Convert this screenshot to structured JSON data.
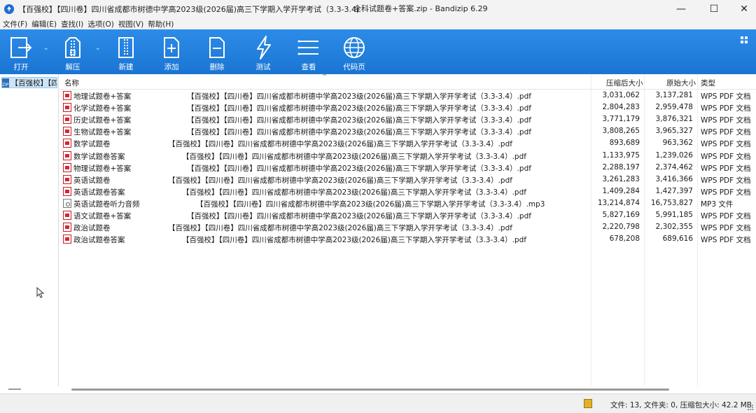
{
  "window": {
    "title_left": "【百强校】【四川卷】四川省成都市树德中学高2023级(2026届)高三下学期入学开学考试（3.3-3.4)",
    "title_center": "全科试题卷+答案.zip - Bandizip 6.29",
    "min_glyph": "—",
    "max_glyph": "☐",
    "close_glyph": "✕"
  },
  "menu": [
    "文件(F)",
    "编辑(E)",
    "查找(I)",
    "选项(O)",
    "视图(V)",
    "帮助(H)"
  ],
  "toolbar": {
    "open": "打开",
    "extract": "解压",
    "new": "新建",
    "add": "添加",
    "delete": "删除",
    "test": "测试",
    "view": "查看",
    "codepage": "代码页"
  },
  "tree": {
    "root_label": "【百强校】【四",
    "zip_label": "ZIP"
  },
  "columns": {
    "name": "名称",
    "compressed": "压缩后大小",
    "original": "原始大小",
    "type": "类型"
  },
  "files": [
    {
      "name": "地理试题卷+答案",
      "path": "【百强校】【四川卷】四川省成都市树德中学高2023级(2026届)高三下学期入学开学考试（3.3-3.4）.pdf",
      "compressed": "3,031,062",
      "original": "3,137,281",
      "type": "WPS PDF 文档"
    },
    {
      "name": "化学试题卷+答案",
      "path": "【百强校】【四川卷】四川省成都市树德中学高2023级(2026届)高三下学期入学开学考试（3.3-3.4）.pdf",
      "compressed": "2,804,283",
      "original": "2,959,478",
      "type": "WPS PDF 文档"
    },
    {
      "name": "历史试题卷+答案",
      "path": "【百强校】【四川卷】四川省成都市树德中学高2023级(2026届)高三下学期入学开学考试（3.3-3.4）.pdf",
      "compressed": "3,771,179",
      "original": "3,876,321",
      "type": "WPS PDF 文档"
    },
    {
      "name": "生物试题卷+答案",
      "path": "【百强校】【四川卷】四川省成都市树德中学高2023级(2026届)高三下学期入学开学考试（3.3-3.4）.pdf",
      "compressed": "3,808,265",
      "original": "3,965,327",
      "type": "WPS PDF 文档"
    },
    {
      "name": "数学试题卷",
      "path": "【百强校】【四川卷】四川省成都市树德中学高2023级(2026届)高三下学期入学开学考试（3.3-3.4）.pdf",
      "compressed": "893,689",
      "original": "963,362",
      "type": "WPS PDF 文档"
    },
    {
      "name": "数学试题卷答案",
      "path": "【百强校】【四川卷】四川省成都市树德中学高2023级(2026届)高三下学期入学开学考试（3.3-3.4）.pdf",
      "compressed": "1,133,975",
      "original": "1,239,026",
      "type": "WPS PDF 文档"
    },
    {
      "name": "物理试题卷+答案",
      "path": "【百强校】【四川卷】四川省成都市树德中学高2023级(2026届)高三下学期入学开学考试（3.3-3.4）.pdf",
      "compressed": "2,288,197",
      "original": "2,374,462",
      "type": "WPS PDF 文档"
    },
    {
      "name": "英语试题卷",
      "path": "【百强校】【四川卷】四川省成都市树德中学高2023级(2026届)高三下学期入学开学考试（3.3-3.4）.pdf",
      "compressed": "3,261,283",
      "original": "3,416,366",
      "type": "WPS PDF 文档"
    },
    {
      "name": "英语试题卷答案",
      "path": "【百强校】【四川卷】四川省成都市树德中学高2023级(2026届)高三下学期入学开学考试（3.3-3.4）.pdf",
      "compressed": "1,409,284",
      "original": "1,427,397",
      "type": "WPS PDF 文档"
    },
    {
      "name": "英语试题卷听力音频",
      "path": "【百强校】【四川卷】四川省成都市树德中学高2023级(2026届)高三下学期入学开学考试（3.3-3.4）.mp3",
      "compressed": "13,214,874",
      "original": "16,753,827",
      "type": "MP3 文件"
    },
    {
      "name": "语文试题卷+答案",
      "path": "【百强校】【四川卷】四川省成都市树德中学高2023级(2026届)高三下学期入学开学考试（3.3-3.4）.pdf",
      "compressed": "5,827,169",
      "original": "5,991,185",
      "type": "WPS PDF 文档"
    },
    {
      "name": "政治试题卷",
      "path": "【百强校】【四川卷】四川省成都市树德中学高2023级(2026届)高三下学期入学开学考试（3.3-3.4）.pdf",
      "compressed": "2,220,798",
      "original": "2,302,355",
      "type": "WPS PDF 文档"
    },
    {
      "name": "政治试题卷答案",
      "path": "【百强校】【四川卷】四川省成都市树德中学高2023级(2026届)高三下学期入学开学考试（3.3-3.4）.pdf",
      "compressed": "678,208",
      "original": "689,616",
      "type": "WPS PDF 文档"
    }
  ],
  "status": {
    "text": "文件: 13, 文件夹: 0, 压缩包大小: 42.2 MB"
  },
  "colors": {
    "toolbar": "#1f7dda",
    "selection": "#cce4f7"
  }
}
